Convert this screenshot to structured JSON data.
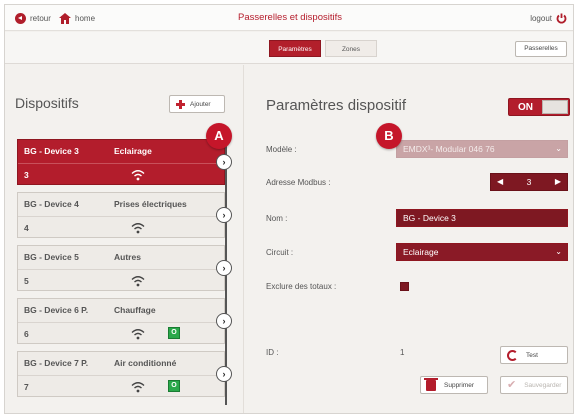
{
  "topbar": {
    "back_label": "retour",
    "home_label": "home",
    "title": "Passerelles et dispositifs",
    "logout_label": "logout"
  },
  "tabs": [
    {
      "label": "Paramètres",
      "active": true
    },
    {
      "label": "Zones",
      "active": false
    }
  ],
  "passerelles_label": "Passerelles",
  "left": {
    "heading": "Dispositifs",
    "add_label": "Ajouter",
    "devices": [
      {
        "name": "BG - Device 3",
        "type": "Eclairage",
        "num": "3",
        "module": "",
        "selected": true
      },
      {
        "name": "BG - Device 4",
        "type": "Prises électriques",
        "num": "4",
        "module": "",
        "selected": false
      },
      {
        "name": "BG - Device 5",
        "type": "Autres",
        "num": "5",
        "module": "",
        "selected": false
      },
      {
        "name": "BG - Device 6 P.",
        "type": "Chauffage",
        "num": "6",
        "module": "O",
        "selected": false
      },
      {
        "name": "BG - Device 7 P.",
        "type": "Air conditionné",
        "num": "7",
        "module": "O",
        "selected": false
      }
    ]
  },
  "markers": {
    "a": "A",
    "b": "B"
  },
  "right": {
    "heading": "Paramètres dispositif",
    "toggle_label": "ON",
    "modele_label": "Modèle :",
    "modele_value": "EMDX³- Modular 046 76",
    "adresse_label": "Adresse Modbus :",
    "adresse_value": "3",
    "nom_label": "Nom :",
    "nom_value": "BG - Device 3",
    "circuit_label": "Circuit :",
    "circuit_value": "Eclairage",
    "exclure_label": "Exclure des totaux :",
    "id_label": "ID :",
    "id_value": "1",
    "test_label": "Test",
    "supprimer_label": "Supprimer",
    "sauvegarder_label": "Sauvegarder"
  },
  "colors": {
    "accent": "#b31d2c",
    "accent_dark": "#7e1822",
    "module_green": "#2aa84a"
  }
}
